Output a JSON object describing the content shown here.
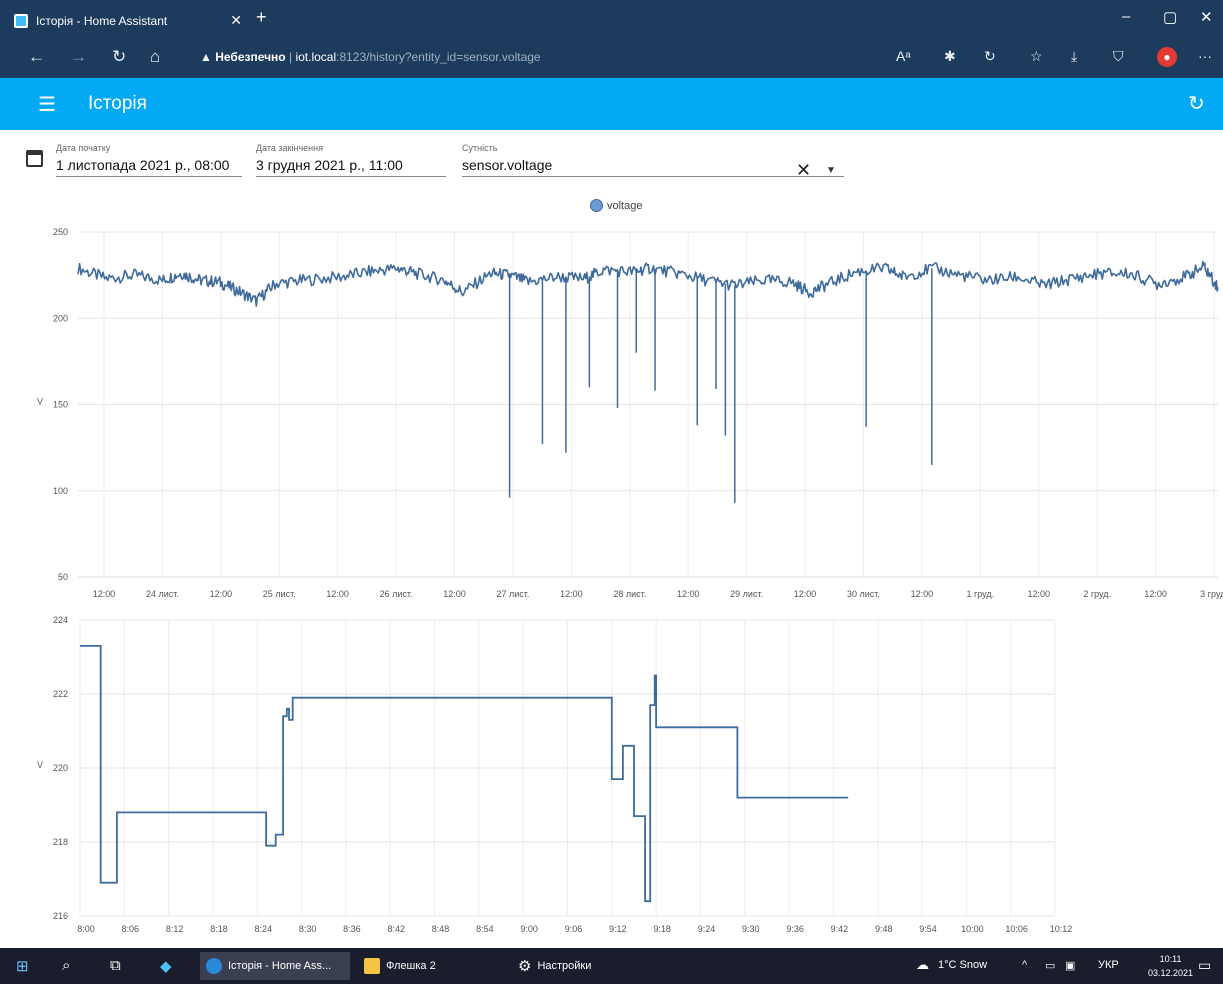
{
  "browser": {
    "tab_title": "Історія - Home Assistant",
    "address_warning": "Небезпечно",
    "address_host": "iot.local",
    "address_path": ":8123/history?entity_id=sensor.voltage"
  },
  "app": {
    "title": "Історія"
  },
  "filters": {
    "start_label": "Дата початку",
    "start_value": "1 листопада 2021 р., 08:00",
    "end_label": "Дата закінчення",
    "end_value": "3 грудня 2021 р., 11:00",
    "entity_label": "Сутність",
    "entity_value": "sensor.voltage"
  },
  "legend": {
    "label": "voltage"
  },
  "chart_data": [
    {
      "type": "line",
      "series": [
        {
          "name": "voltage"
        }
      ],
      "ylabel": "V",
      "ylim": [
        50,
        250
      ],
      "yticks": [
        50,
        100,
        150,
        200,
        250
      ],
      "xticks": [
        "12:00",
        "24 лист.",
        "12:00",
        "25 лист.",
        "12:00",
        "26 лист.",
        "12:00",
        "27 лист.",
        "12:00",
        "28 лист.",
        "12:00",
        "29 лист.",
        "12:00",
        "30 лист.",
        "12:00",
        "1 груд.",
        "12:00",
        "2 груд.",
        "12:00",
        "3 груд."
      ],
      "x_hours_range": [
        0,
        243
      ],
      "baseline": [
        [
          0,
          229
        ],
        [
          6,
          223
        ],
        [
          12,
          225
        ],
        [
          18,
          222
        ],
        [
          22,
          226
        ],
        [
          26,
          222
        ],
        [
          30,
          221
        ],
        [
          34,
          216
        ],
        [
          38,
          210
        ],
        [
          42,
          220
        ],
        [
          48,
          222
        ],
        [
          56,
          224
        ],
        [
          62,
          227
        ],
        [
          68,
          229
        ],
        [
          72,
          226
        ],
        [
          78,
          222
        ],
        [
          82,
          215
        ],
        [
          88,
          226
        ],
        [
          92,
          225
        ],
        [
          96,
          221
        ],
        [
          102,
          224
        ],
        [
          108,
          223
        ],
        [
          112,
          228
        ],
        [
          118,
          227
        ],
        [
          122,
          229
        ],
        [
          128,
          226
        ],
        [
          134,
          222
        ],
        [
          140,
          219
        ],
        [
          146,
          222
        ],
        [
          152,
          221
        ],
        [
          156,
          215
        ],
        [
          160,
          220
        ],
        [
          166,
          227
        ],
        [
          172,
          229
        ],
        [
          176,
          224
        ],
        [
          182,
          229
        ],
        [
          188,
          225
        ],
        [
          194,
          222
        ],
        [
          200,
          224
        ],
        [
          206,
          219
        ],
        [
          212,
          223
        ],
        [
          218,
          226
        ],
        [
          224,
          226
        ],
        [
          230,
          220
        ],
        [
          236,
          224
        ],
        [
          240,
          230
        ],
        [
          243,
          218
        ]
      ],
      "spikes": [
        [
          92,
          96
        ],
        [
          99,
          127
        ],
        [
          104,
          122
        ],
        [
          109,
          160
        ],
        [
          115,
          148
        ],
        [
          119,
          180
        ],
        [
          123,
          158
        ],
        [
          132,
          138
        ],
        [
          136,
          159
        ],
        [
          138,
          132
        ],
        [
          140,
          93
        ],
        [
          168,
          137
        ],
        [
          182,
          115
        ]
      ]
    },
    {
      "type": "line",
      "series": [
        {
          "name": "voltage"
        }
      ],
      "ylabel": "V",
      "ylim": [
        216,
        224
      ],
      "yticks": [
        216,
        218,
        220,
        222,
        224
      ],
      "xticks": [
        "8:00",
        "8:06",
        "8:12",
        "8:18",
        "8:24",
        "8:30",
        "8:36",
        "8:42",
        "8:48",
        "8:54",
        "9:00",
        "9:06",
        "9:12",
        "9:18",
        "9:24",
        "9:30",
        "9:36",
        "9:42",
        "9:48",
        "9:54",
        "10:00",
        "10:06",
        "10:12"
      ],
      "x_minutes_range": [
        0,
        132
      ],
      "steps": [
        [
          0,
          223.3
        ],
        [
          2.8,
          216.9
        ],
        [
          5,
          218.8
        ],
        [
          25.2,
          217.9
        ],
        [
          26.5,
          218.2
        ],
        [
          27.5,
          221.4
        ],
        [
          28,
          221.6
        ],
        [
          28.3,
          221.3
        ],
        [
          28.8,
          221.9
        ],
        [
          72,
          219.7
        ],
        [
          73.5,
          220.6
        ],
        [
          75,
          218.7
        ],
        [
          76.5,
          216.4
        ],
        [
          77.2,
          221.7
        ],
        [
          77.8,
          222.5
        ],
        [
          78,
          221.1
        ],
        [
          89,
          219.2
        ],
        [
          104,
          219.2
        ]
      ]
    }
  ],
  "taskbar": {
    "task1": "Історія - Home Ass...",
    "task2": "Флешка 2",
    "task3": "Настройки",
    "weather": "1°C Snow",
    "lang": "УКР",
    "time": "10:11",
    "date": "03.12.2021"
  }
}
